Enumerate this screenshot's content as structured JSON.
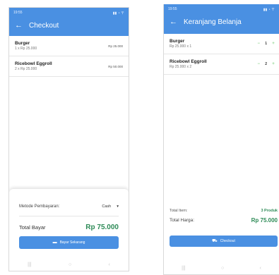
{
  "left": {
    "status": {
      "time": "19:55",
      "icons": "▮▮ ◔ 〒"
    },
    "title": "Checkout",
    "items": [
      {
        "name": "Burger",
        "sub": "1 x Rp 25.000",
        "total": "Rp 25.000"
      },
      {
        "name": "Ricebowl Eggroll",
        "sub": "2 x Rp 25.000",
        "total": "Rp 50.000"
      }
    ],
    "payment": {
      "label": "Metode Pembayaran:",
      "value": "Cash"
    },
    "total": {
      "label": "Total Bayar",
      "value": "Rp 75.000"
    },
    "pay_button": {
      "label": "Bayar Sekarang",
      "icon": "payment-icon"
    }
  },
  "right": {
    "status": {
      "time": "19:55",
      "icons": "▮▮ ◔ 〒"
    },
    "title": "Keranjang Belanja",
    "items": [
      {
        "name": "Burger",
        "sub": "Rp 25.000 x 1",
        "qty": "1"
      },
      {
        "name": "Ricebowl Eggroll",
        "sub": "Rp 25.000 x 2",
        "qty": "2"
      }
    ],
    "summary": {
      "items_label": "Total Item:",
      "items_value": "3 Produk",
      "price_label": "Total Harga:",
      "price_value": "Rp 75.000"
    },
    "checkout_button": {
      "label": "Checkout",
      "icon": "cart-icon"
    }
  },
  "colors": {
    "primary": "#4a90e2",
    "accent_green": "#2e8b57",
    "stepper": "#8fd48f"
  }
}
